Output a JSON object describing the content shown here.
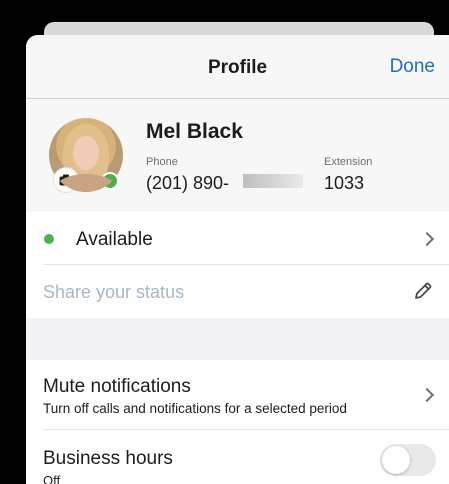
{
  "header": {
    "title": "Profile",
    "done_label": "Done"
  },
  "profile": {
    "name": "Mel Black",
    "phone_label": "Phone",
    "phone_value": "(201) 890-",
    "extension_label": "Extension",
    "extension_value": "1033",
    "presence_color": "#4caf50"
  },
  "availability": {
    "label": "Available"
  },
  "status": {
    "placeholder": "Share your status"
  },
  "settings": {
    "mute": {
      "title": "Mute notifications",
      "subtitle": "Turn off calls and notifications for a selected period"
    },
    "business_hours": {
      "title": "Business hours",
      "subtitle": "Off",
      "enabled": false
    }
  },
  "colors": {
    "accent": "#1f6ec8",
    "available": "#4caf50"
  }
}
